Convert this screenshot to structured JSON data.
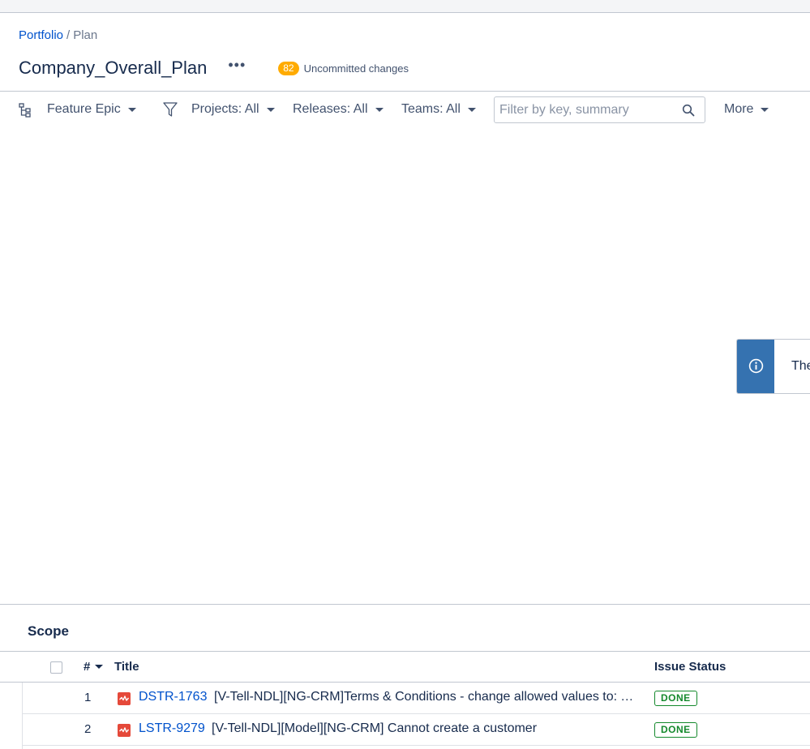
{
  "breadcrumb": {
    "root": "Portfolio",
    "separator": "/",
    "current": "Plan"
  },
  "plan": {
    "title": "Company_Overall_Plan",
    "more_menu": "•••",
    "uncommitted_count": "82",
    "uncommitted_label": "Uncommitted changes"
  },
  "toolbar": {
    "hierarchy": "Feature Epic",
    "projects": "Projects: All",
    "releases": "Releases: All",
    "teams": "Teams: All",
    "search_placeholder": "Filter by key, summary",
    "more": "More"
  },
  "flag": {
    "text": "The"
  },
  "scope": {
    "title": "Scope",
    "columns": {
      "number": "#",
      "title": "Title",
      "status": "Issue Status"
    },
    "rows": [
      {
        "num": "1",
        "key": "DSTR-1763",
        "summary": "[V-Tell-NDL][NG-CRM]Terms & Conditions - change allowed values to: Y…",
        "status": "DONE"
      },
      {
        "num": "2",
        "key": "LSTR-9279",
        "summary": "[V-Tell-NDL][Model][NG-CRM] Cannot create a customer",
        "status": "DONE"
      }
    ]
  },
  "colors": {
    "link": "#0052cc",
    "badge": "#ffab00",
    "flag_strip": "#3572b0",
    "done": "#14892c",
    "bug": "#e5493a"
  }
}
